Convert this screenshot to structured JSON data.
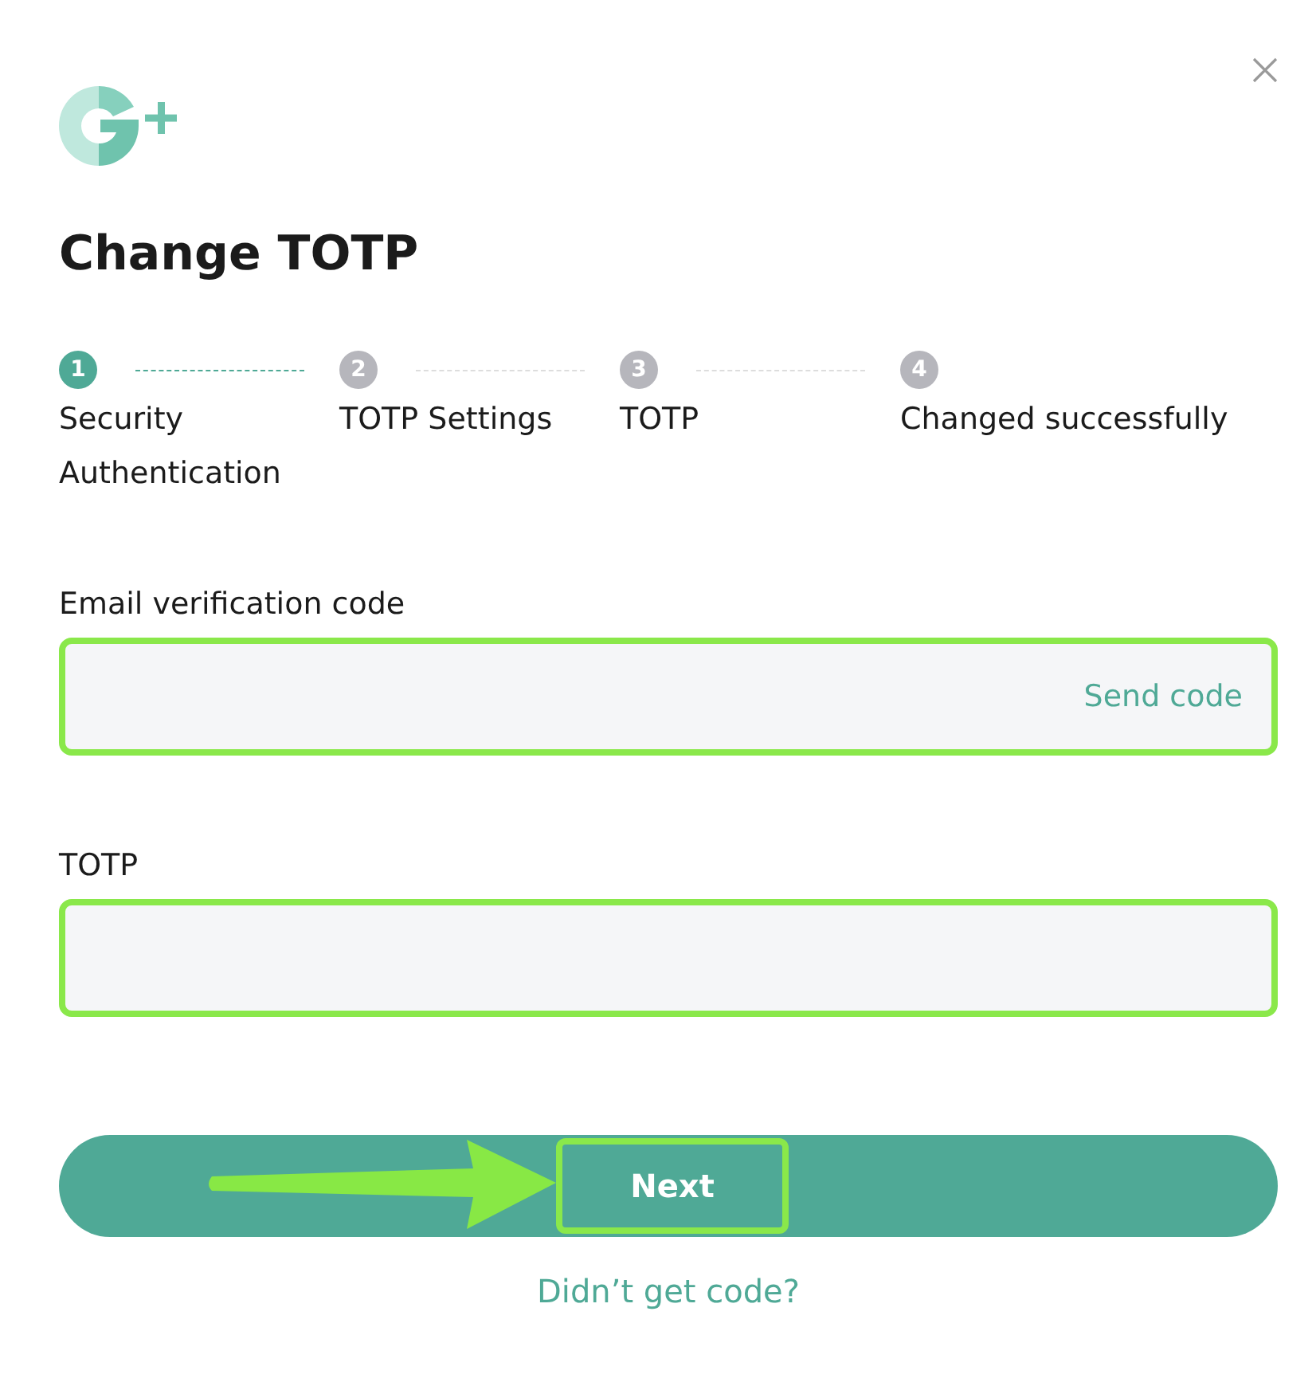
{
  "dialog": {
    "title": "Change TOTP"
  },
  "steps": [
    {
      "number": "1",
      "label": "Security Authentication",
      "selected": true
    },
    {
      "number": "2",
      "label": "TOTP Settings",
      "selected": false
    },
    {
      "number": "3",
      "label": "TOTP",
      "selected": false
    },
    {
      "number": "4",
      "label": "Changed successfully",
      "selected": false
    }
  ],
  "fields": [
    {
      "label": "Email verification code",
      "action": "Send code",
      "highlighted": true
    },
    {
      "label": "TOTP",
      "highlighted": true
    }
  ],
  "next_button": {
    "label": "Next",
    "highlighted": true
  },
  "help_link": "Didn’t get code?",
  "annotation_arrow": {
    "shown": true
  }
}
